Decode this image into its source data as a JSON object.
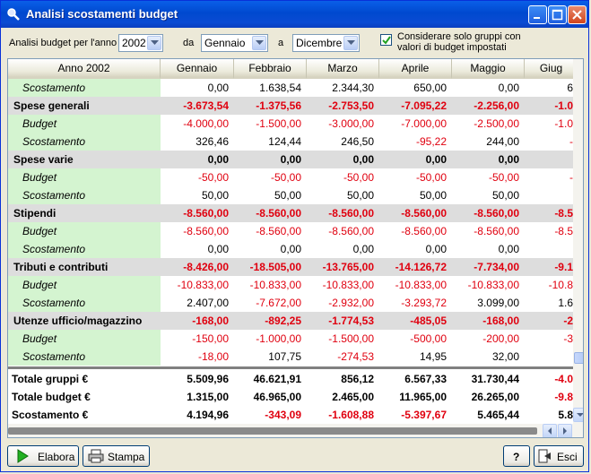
{
  "window": {
    "title": "Analisi scostamenti budget"
  },
  "filters": {
    "year_label": "Analisi budget per l'anno",
    "year_value": "2002",
    "from_label": "da",
    "from_value": "Gennaio",
    "to_label": "a",
    "to_value": "Dicembre",
    "checkbox_line1": "Considerare solo gruppi con",
    "checkbox_line2": "valori di budget impostati",
    "checkbox_checked": true
  },
  "table": {
    "columns": [
      "Anno 2002",
      "Gennaio",
      "Febbraio",
      "Marzo",
      "Aprile",
      "Maggio",
      "Giug"
    ],
    "rows": [
      {
        "type": "sub",
        "name": "Scostamento",
        "values": [
          "0,00",
          "1.638,54",
          "2.344,30",
          "650,00",
          "0,00",
          "6"
        ]
      },
      {
        "type": "group",
        "name": "Spese generali",
        "values": [
          "-3.673,54",
          "-1.375,56",
          "-2.753,50",
          "-7.095,22",
          "-2.256,00",
          "-1.0"
        ]
      },
      {
        "type": "sub",
        "name": "Budget",
        "values": [
          "-4.000,00",
          "-1.500,00",
          "-3.000,00",
          "-7.000,00",
          "-2.500,00",
          "-1.0"
        ]
      },
      {
        "type": "sub",
        "name": "Scostamento",
        "values": [
          "326,46",
          "124,44",
          "246,50",
          "-95,22",
          "244,00",
          "-"
        ]
      },
      {
        "type": "group",
        "name": "Spese varie",
        "values": [
          "0,00",
          "0,00",
          "0,00",
          "0,00",
          "0,00",
          ""
        ]
      },
      {
        "type": "sub",
        "name": "Budget",
        "values": [
          "-50,00",
          "-50,00",
          "-50,00",
          "-50,00",
          "-50,00",
          "-"
        ]
      },
      {
        "type": "sub",
        "name": "Scostamento",
        "values": [
          "50,00",
          "50,00",
          "50,00",
          "50,00",
          "50,00",
          ""
        ]
      },
      {
        "type": "group",
        "name": "Stipendi",
        "values": [
          "-8.560,00",
          "-8.560,00",
          "-8.560,00",
          "-8.560,00",
          "-8.560,00",
          "-8.5"
        ]
      },
      {
        "type": "sub",
        "name": "Budget",
        "values": [
          "-8.560,00",
          "-8.560,00",
          "-8.560,00",
          "-8.560,00",
          "-8.560,00",
          "-8.5"
        ]
      },
      {
        "type": "sub",
        "name": "Scostamento",
        "values": [
          "0,00",
          "0,00",
          "0,00",
          "0,00",
          "0,00",
          ""
        ]
      },
      {
        "type": "group",
        "name": "Tributi e contributi",
        "values": [
          "-8.426,00",
          "-18.505,00",
          "-13.765,00",
          "-14.126,72",
          "-7.734,00",
          "-9.1"
        ]
      },
      {
        "type": "sub",
        "name": "Budget",
        "values": [
          "-10.833,00",
          "-10.833,00",
          "-10.833,00",
          "-10.833,00",
          "-10.833,00",
          "-10.8"
        ]
      },
      {
        "type": "sub",
        "name": "Scostamento",
        "values": [
          "2.407,00",
          "-7.672,00",
          "-2.932,00",
          "-3.293,72",
          "3.099,00",
          "1.6"
        ]
      },
      {
        "type": "group",
        "name": "Utenze ufficio/magazzino",
        "values": [
          "-168,00",
          "-892,25",
          "-1.774,53",
          "-485,05",
          "-168,00",
          "-2"
        ]
      },
      {
        "type": "sub",
        "name": "Budget",
        "values": [
          "-150,00",
          "-1.000,00",
          "-1.500,00",
          "-500,00",
          "-200,00",
          "-3"
        ]
      },
      {
        "type": "sub",
        "name": "Scostamento",
        "values": [
          "-18,00",
          "107,75",
          "-274,53",
          "14,95",
          "32,00",
          ""
        ]
      }
    ],
    "totals": [
      {
        "name": "Totale gruppi €",
        "values": [
          "5.509,96",
          "46.621,91",
          "856,12",
          "6.567,33",
          "31.730,44",
          "-4.0"
        ]
      },
      {
        "name": "Totale budget €",
        "values": [
          "1.315,00",
          "46.965,00",
          "2.465,00",
          "11.965,00",
          "26.265,00",
          "-9.8"
        ]
      },
      {
        "name": "Scostamento €",
        "values": [
          "4.194,96",
          "-343,09",
          "-1.608,88",
          "-5.397,67",
          "5.465,44",
          "5.8"
        ]
      }
    ]
  },
  "buttons": {
    "elabora": "Elabora",
    "stampa": "Stampa",
    "help": "?",
    "esci": "Esci"
  },
  "colors": {
    "negative": "#e0000f",
    "subrow_name_bg": "#d4f4d0",
    "group_bg": "#dddddd",
    "titlebar": "#0a5fe8"
  },
  "icons": [
    "magnifier-icon",
    "minimize-icon",
    "maximize-icon",
    "close-icon",
    "play-icon",
    "printer-icon",
    "help-icon",
    "exit-icon",
    "checkmark-icon",
    "dropdown-arrow-icon"
  ]
}
